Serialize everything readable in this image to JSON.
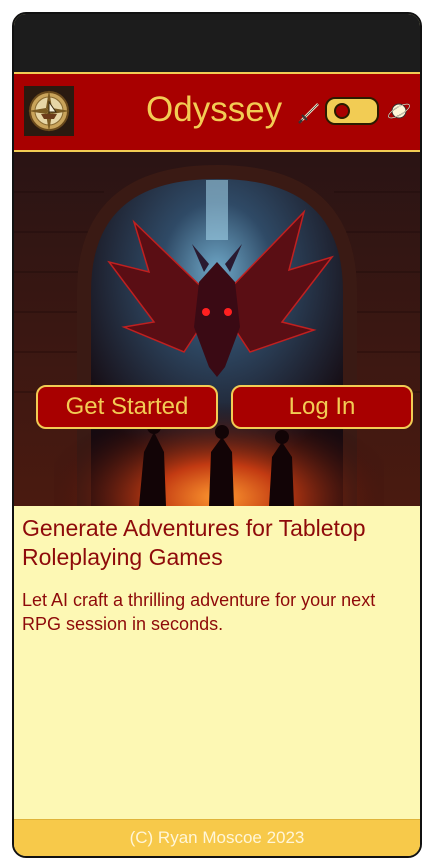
{
  "header": {
    "title": "Odyssey",
    "logo_icon": "compass-ship-logo-icon",
    "left_icon": "sword-icon",
    "right_icon": "planet-icon",
    "theme_toggle": {
      "state": "off"
    },
    "colors": {
      "background": "#a80000",
      "accent": "#f2cc54"
    }
  },
  "hero": {
    "image": "dragon-dungeon-illustration",
    "buttons": {
      "get_started": "Get Started",
      "log_in": "Log In"
    }
  },
  "main": {
    "headline": "Generate Adventures for Tabletop Roleplaying Games",
    "description": "Let AI craft a thrilling adventure for your next RPG session in seconds.",
    "colors": {
      "background": "#fdf8b4",
      "text": "#8e0a0a"
    }
  },
  "footer": {
    "text": "(C) Ryan Moscoe 2023",
    "colors": {
      "background": "#f7c94a"
    }
  }
}
